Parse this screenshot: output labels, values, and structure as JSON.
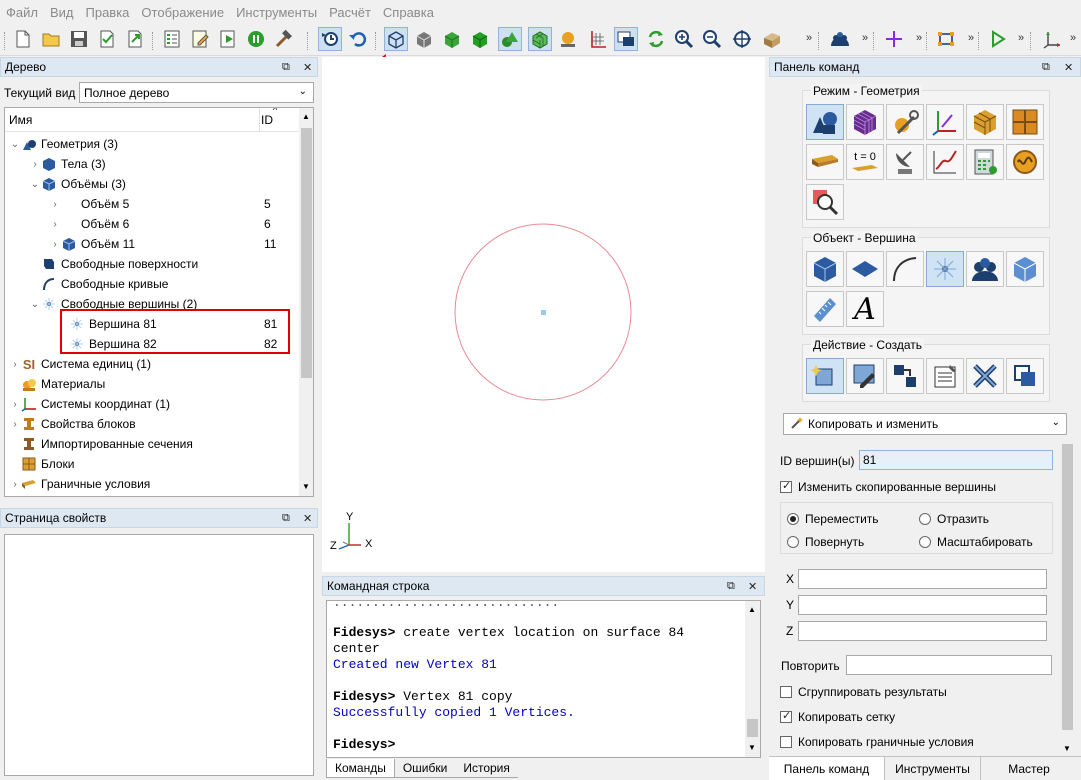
{
  "menu": [
    "Файл",
    "Вид",
    "Правка",
    "Отображение",
    "Инструменты",
    "Расчёт",
    "Справка"
  ],
  "tree_panel": {
    "title": "Дерево",
    "view_label": "Текущий вид",
    "view_value": "Полное дерево",
    "col_name": "Имя",
    "col_id": "ID",
    "rows": [
      {
        "label": "Геометрия (3)",
        "id": ""
      },
      {
        "label": "Тела (3)",
        "id": ""
      },
      {
        "label": "Объёмы (3)",
        "id": ""
      },
      {
        "label": "Объём 5",
        "id": "5"
      },
      {
        "label": "Объём 6",
        "id": "6"
      },
      {
        "label": "Объём 11",
        "id": "11"
      },
      {
        "label": "Свободные поверхности",
        "id": ""
      },
      {
        "label": "Свободные кривые",
        "id": ""
      },
      {
        "label": "Свободные вершины (2)",
        "id": ""
      },
      {
        "label": "Вершина 81",
        "id": "81"
      },
      {
        "label": "Вершина 82",
        "id": "82"
      },
      {
        "label": "Система единиц (1)",
        "id": ""
      },
      {
        "label": "Материалы",
        "id": ""
      },
      {
        "label": "Системы координат (1)",
        "id": ""
      },
      {
        "label": "Свойства блоков",
        "id": ""
      },
      {
        "label": "Импортированные сечения",
        "id": ""
      },
      {
        "label": "Блоки",
        "id": ""
      },
      {
        "label": "Граничные условия",
        "id": ""
      }
    ]
  },
  "props_panel": {
    "title": "Страница свойств"
  },
  "triad": {
    "y": "Y",
    "z": "Z",
    "x": "X"
  },
  "console": {
    "title": "Командная строка",
    "lines": [
      {
        "prompt": "Fidesys>",
        "text": "create vertex location on surface 84",
        "kind": "cmd"
      },
      {
        "prompt": "",
        "text": "center",
        "kind": "cmd"
      },
      {
        "prompt": "",
        "text": "Created new Vertex 81",
        "kind": "out"
      },
      {
        "prompt": "Fidesys>",
        "text": "Vertex 81 copy",
        "kind": "cmd"
      },
      {
        "prompt": "",
        "text": "Successfully copied 1 Vertices.",
        "kind": "out"
      },
      {
        "prompt": "Fidesys>",
        "text": "",
        "kind": "cmd"
      }
    ],
    "tabs": [
      "Команды",
      "Ошибки",
      "История"
    ]
  },
  "command_panel": {
    "title": "Панель команд",
    "group_mode": "Режим - Геометрия",
    "group_object": "Объект - Вершина",
    "group_action": "Действие - Создать",
    "t0_label": "t = 0",
    "operation": "Копировать и изменить",
    "vertex_id_label": "ID вершин(ы)",
    "vertex_id_value": "81",
    "modify_copies": "Изменить скопированные вершины",
    "radio": {
      "move": "Переместить",
      "reflect": "Отразить",
      "rotate": "Повернуть",
      "scale": "Масштабировать"
    },
    "x_label": "X",
    "y_label": "Y",
    "z_label": "Z",
    "repeat_label": "Повторить",
    "group_results": "Сгруппировать результаты",
    "copy_mesh": "Копировать сетку",
    "copy_bc": "Копировать граничные условия",
    "tabs": [
      "Панель команд",
      "Инструменты",
      "Мастер"
    ]
  },
  "colors": {
    "accent": "#cde0f2",
    "highlight": "#e00000",
    "created": "#0000cc",
    "circle": "#e88a95"
  }
}
